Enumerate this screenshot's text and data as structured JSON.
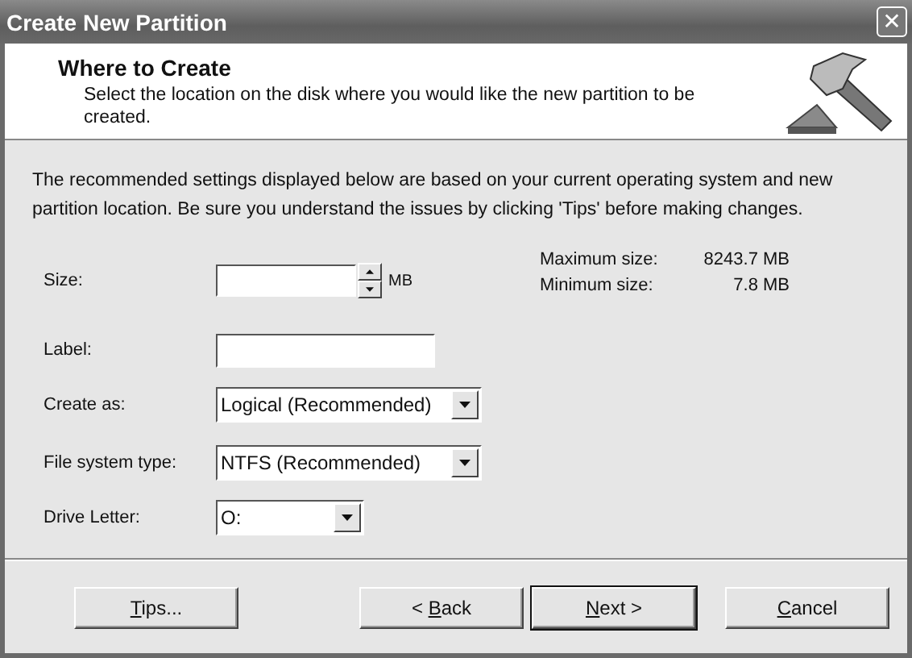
{
  "window": {
    "title": "Create New Partition",
    "close": "✕"
  },
  "header": {
    "title": "Where to Create",
    "subtitle": "Select the location on the disk where you would like the new partition to be created."
  },
  "intro": "The recommended settings displayed below are based on your current operating system and new partition location. Be sure you understand the issues by clicking 'Tips' before making changes.",
  "fields": [
    {
      "kind": "spin",
      "label": "Size:",
      "unit": "MB"
    },
    {
      "kind": "text",
      "label": "Label:"
    },
    {
      "kind": "combo",
      "label": "Create as:",
      "value": "Logical (Recommended)"
    },
    {
      "kind": "combo",
      "label": "File system type:",
      "value": "NTFS (Recommended)"
    },
    {
      "kind": "combo-small",
      "label": "Drive Letter:",
      "value": "O:"
    }
  ],
  "limits": [
    {
      "label": "Maximum size:",
      "value": "8243.7 MB"
    },
    {
      "label": "Minimum size:",
      "value": "7.8 MB"
    }
  ],
  "buttons": [
    {
      "key": "T",
      "post": "ips...",
      "default": false
    },
    {
      "pre": "< ",
      "key": "B",
      "post": "ack",
      "default": false
    },
    {
      "key": "N",
      "post": "ext >",
      "default": true
    },
    {
      "key": "C",
      "post": "ancel",
      "default": false
    }
  ]
}
